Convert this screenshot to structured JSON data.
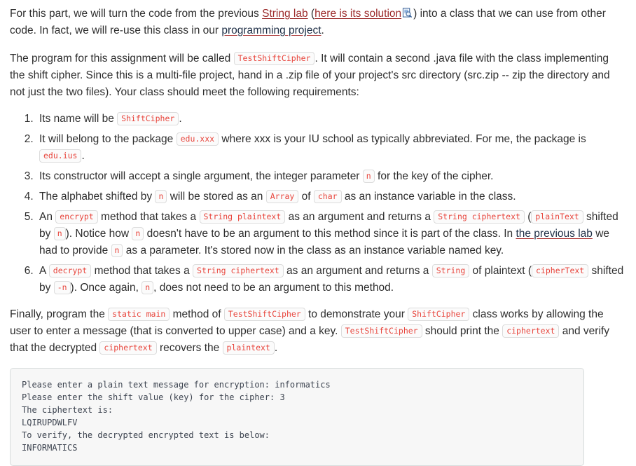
{
  "intro": {
    "p1_a": "For this part, we will turn the code from the previous ",
    "link_string_lab": "String lab",
    "p1_b": " (",
    "link_solution": "here is its solution",
    "icon_name": "document-preview-icon",
    "p1_c": ") into a class that we can use from other code. In fact, we will re-use this class in our ",
    "link_project": "programming project",
    "p1_d": ".",
    "p2_a": "The program for this assignment will be called ",
    "code_testshiftcipher": "TestShiftCipher",
    "p2_b": ". It will contain a second .java file with the class implementing the shift cipher. Since this is a multi-file project, hand in a .zip file of your project's src directory (src.zip -- zip the directory and not just the two files). Your class should meet the following requirements:"
  },
  "requirements": {
    "item1": {
      "a": "Its name will be ",
      "code1": "ShiftCipher",
      "b": "."
    },
    "item2": {
      "a": "It will belong to the package ",
      "code1": "edu.xxx",
      "b": " where xxx is your IU school as typically abbreviated. For me, the package is ",
      "code2": "edu.ius",
      "c": "."
    },
    "item3": {
      "a": "Its constructor will accept a single argument, the integer parameter ",
      "code1": "n",
      "b": " for the key of the cipher."
    },
    "item4": {
      "a": "The alphabet shifted by ",
      "code1": "n",
      "b": " will be stored as an ",
      "code2": "Array",
      "c": " of ",
      "code3": "char",
      "d": " as an instance variable in the class."
    },
    "item5": {
      "a": "An ",
      "code1": "encrypt",
      "b": " method that takes a ",
      "code2": "String plaintext",
      "c": " as an argument and returns a ",
      "code3": "String ciphertext",
      "d": " (",
      "code4": "plainText",
      "e": " shifted by ",
      "code5": "n",
      "f": "). Notice how ",
      "code6": "n",
      "g": " doesn't have to be an argument to this method since it is part of the class. In ",
      "link_previous_lab": "the previous lab",
      "h": " we had to provide ",
      "code7": "n",
      "i": " as a parameter. It's stored now in the class as an instance variable named key."
    },
    "item6": {
      "a": "A ",
      "code1": "decrypt",
      "b": " method that takes a ",
      "code2": "String ciphertext",
      "c": " as an argument and returns a ",
      "code3": "String",
      "d": " of plaintext (",
      "code4": "cipherText",
      "e": " shifted by ",
      "code5": "-n",
      "f": "). Once again, ",
      "code6": "n",
      "g": ", does not need to be an argument to this method."
    }
  },
  "finally_para": {
    "a": "Finally, program the ",
    "code1": "static main",
    "b": " method of ",
    "code2": "TestShiftCipher",
    "c": " to demonstrate your ",
    "code3": "ShiftCipher",
    "d": " class works by allowing the user to enter a message (that is converted to upper case) and a key. ",
    "code4": "TestShiftCipher",
    "e": " should print the ",
    "code5": "ciphertext",
    "f": " and verify that the decrypted ",
    "code6": "ciphertext",
    "g": " recovers the ",
    "code7": "plaintext",
    "h": "."
  },
  "console": {
    "lines": "Please enter a plain text message for encryption: informatics\nPlease enter the shift value (key) for the cipher: 3\nThe ciphertext is:\nLQIRUPDWLFV\nTo verify, the decrypted encrypted text is below:\nINFORMATICS"
  },
  "colors": {
    "code_text": "#e8453c",
    "link_red": "#9c2b2b",
    "link_dark": "#1f2f46",
    "console_bg": "#f7f7f7",
    "console_border": "#d7dcdc",
    "body_text": "#2e2e2e"
  }
}
